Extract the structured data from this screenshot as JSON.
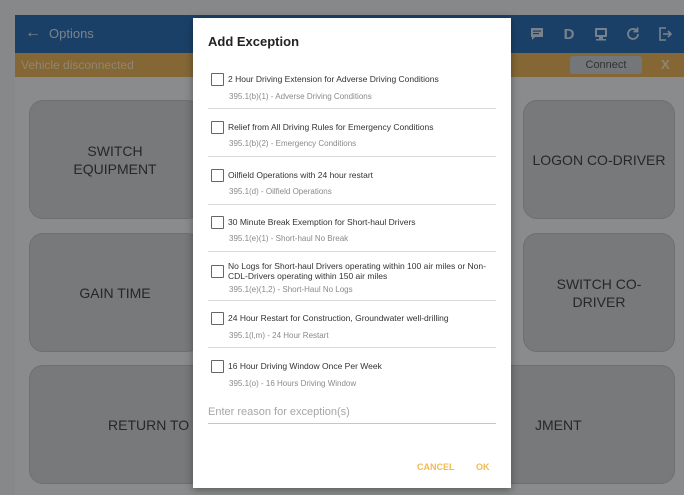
{
  "appbar": {
    "back_glyph": "←",
    "title": "Options",
    "icons": [
      "message-icon",
      "d-status-icon",
      "eld-device-icon",
      "refresh-icon",
      "logout-icon"
    ],
    "d_letter": "D"
  },
  "status": {
    "message": "Vehicle disconnected",
    "connect_label": "Connect",
    "close_label": "X"
  },
  "tiles": {
    "switch_equipment": "SWITCH EQUIPMENT",
    "logon_codriver": "LOGON CO-DRIVER",
    "gain_time": "GAIN TIME",
    "switch_codriver": "SWITCH CO-DRIVER",
    "return_to_home_left": "RETURN TO H",
    "equipment_right": "JMENT"
  },
  "dialog": {
    "title": "Add Exception",
    "options": [
      {
        "label": "2 Hour Driving Extension for Adverse Driving Conditions",
        "sub": "395.1(b)(1) - Adverse Driving Conditions"
      },
      {
        "label": "Relief from All Driving Rules for Emergency Conditions",
        "sub": "395.1(b)(2) - Emergency Conditions"
      },
      {
        "label": "Oilfield Operations with 24 hour restart",
        "sub": "395.1(d) - Oilfield Operations"
      },
      {
        "label": "30 Minute Break Exemption for Short-haul Drivers",
        "sub": "395.1(e)(1) - Short-haul No Break"
      },
      {
        "label": "No Logs for Short-haul Drivers operating within 100 air miles or Non-CDL-Drivers operating within 150 air miles",
        "sub": "395.1(e)(1,2) - Short-Haul No Logs"
      },
      {
        "label": "24 Hour Restart for Construction, Groundwater well-drilling",
        "sub": "395.1(l,m) - 24 Hour Restart"
      },
      {
        "label": "16 Hour Driving Window Once Per Week",
        "sub": "395.1(o) - 16 Hours Driving Window"
      }
    ],
    "reason_placeholder": "Enter reason for exception(s)",
    "cancel_label": "CANCEL",
    "ok_label": "OK"
  },
  "colors": {
    "appbar": "#2f6fb3",
    "status": "#e4b25c",
    "accent": "#f1bb4f"
  }
}
